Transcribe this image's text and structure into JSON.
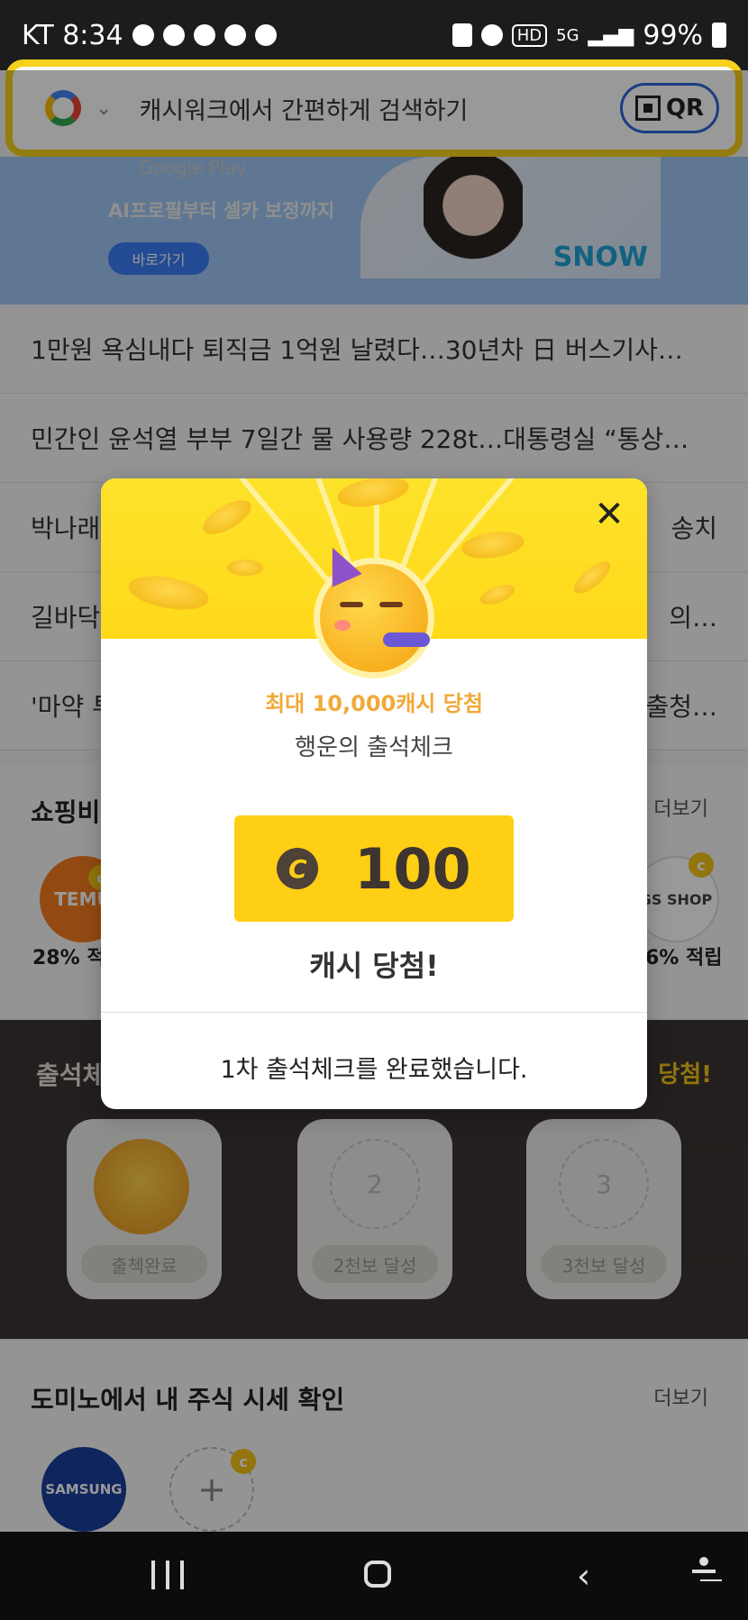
{
  "status_bar": {
    "carrier_time": "KT 8:34",
    "network": "5G",
    "hd": "HD",
    "battery": "99%"
  },
  "search": {
    "placeholder": "캐시워크에서 간편하게 검색하기",
    "qr_label": "QR"
  },
  "banner": {
    "store": "Google Play",
    "copy": "AI프로필부터 셀카 보정까지",
    "button": "바로가기",
    "brand": "SNOW"
  },
  "news": [
    "1만원 욕심내다 퇴직금 1억원 날렸다…30년차 日 버스기사…",
    "민간인 윤석열 부부 7일간 물 사용량 228t…대통령실 “통상…",
    "박나래",
    "길바닥",
    "'마약 투"
  ],
  "news_right": [
    "",
    "",
    "송치",
    "의…",
    "출청…"
  ],
  "shopping": {
    "title": "쇼핑비",
    "more": "더보기",
    "left_logo": "TEMU",
    "left_rate": "28% 적",
    "right_logo": "GS SHOP",
    "right_rate": "6% 적립"
  },
  "attendance": {
    "title": "출석체",
    "right": "당첨!",
    "cards": [
      {
        "label": "출첵완료",
        "number": ""
      },
      {
        "label": "2천보 달성",
        "number": "2"
      },
      {
        "label": "3천보 달성",
        "number": "3"
      }
    ]
  },
  "stock": {
    "title": "도미노에서 내 주식 시세 확인",
    "more": "더보기",
    "samsung": "SAMSUNG",
    "add": "+"
  },
  "modal": {
    "highlight": "최대 10,000캐시 당첨",
    "subtitle": "행운의 출석체크",
    "coin_symbol": "C",
    "amount": "100",
    "result": "캐시 당첨!",
    "complete": "1차 출석체크를 완료했습니다.",
    "close": "✕"
  },
  "colors": {
    "accent": "#fecf14",
    "highlight": "#f0a93a",
    "dark_section": "#3b3533",
    "search_border": "#f6d11b"
  }
}
